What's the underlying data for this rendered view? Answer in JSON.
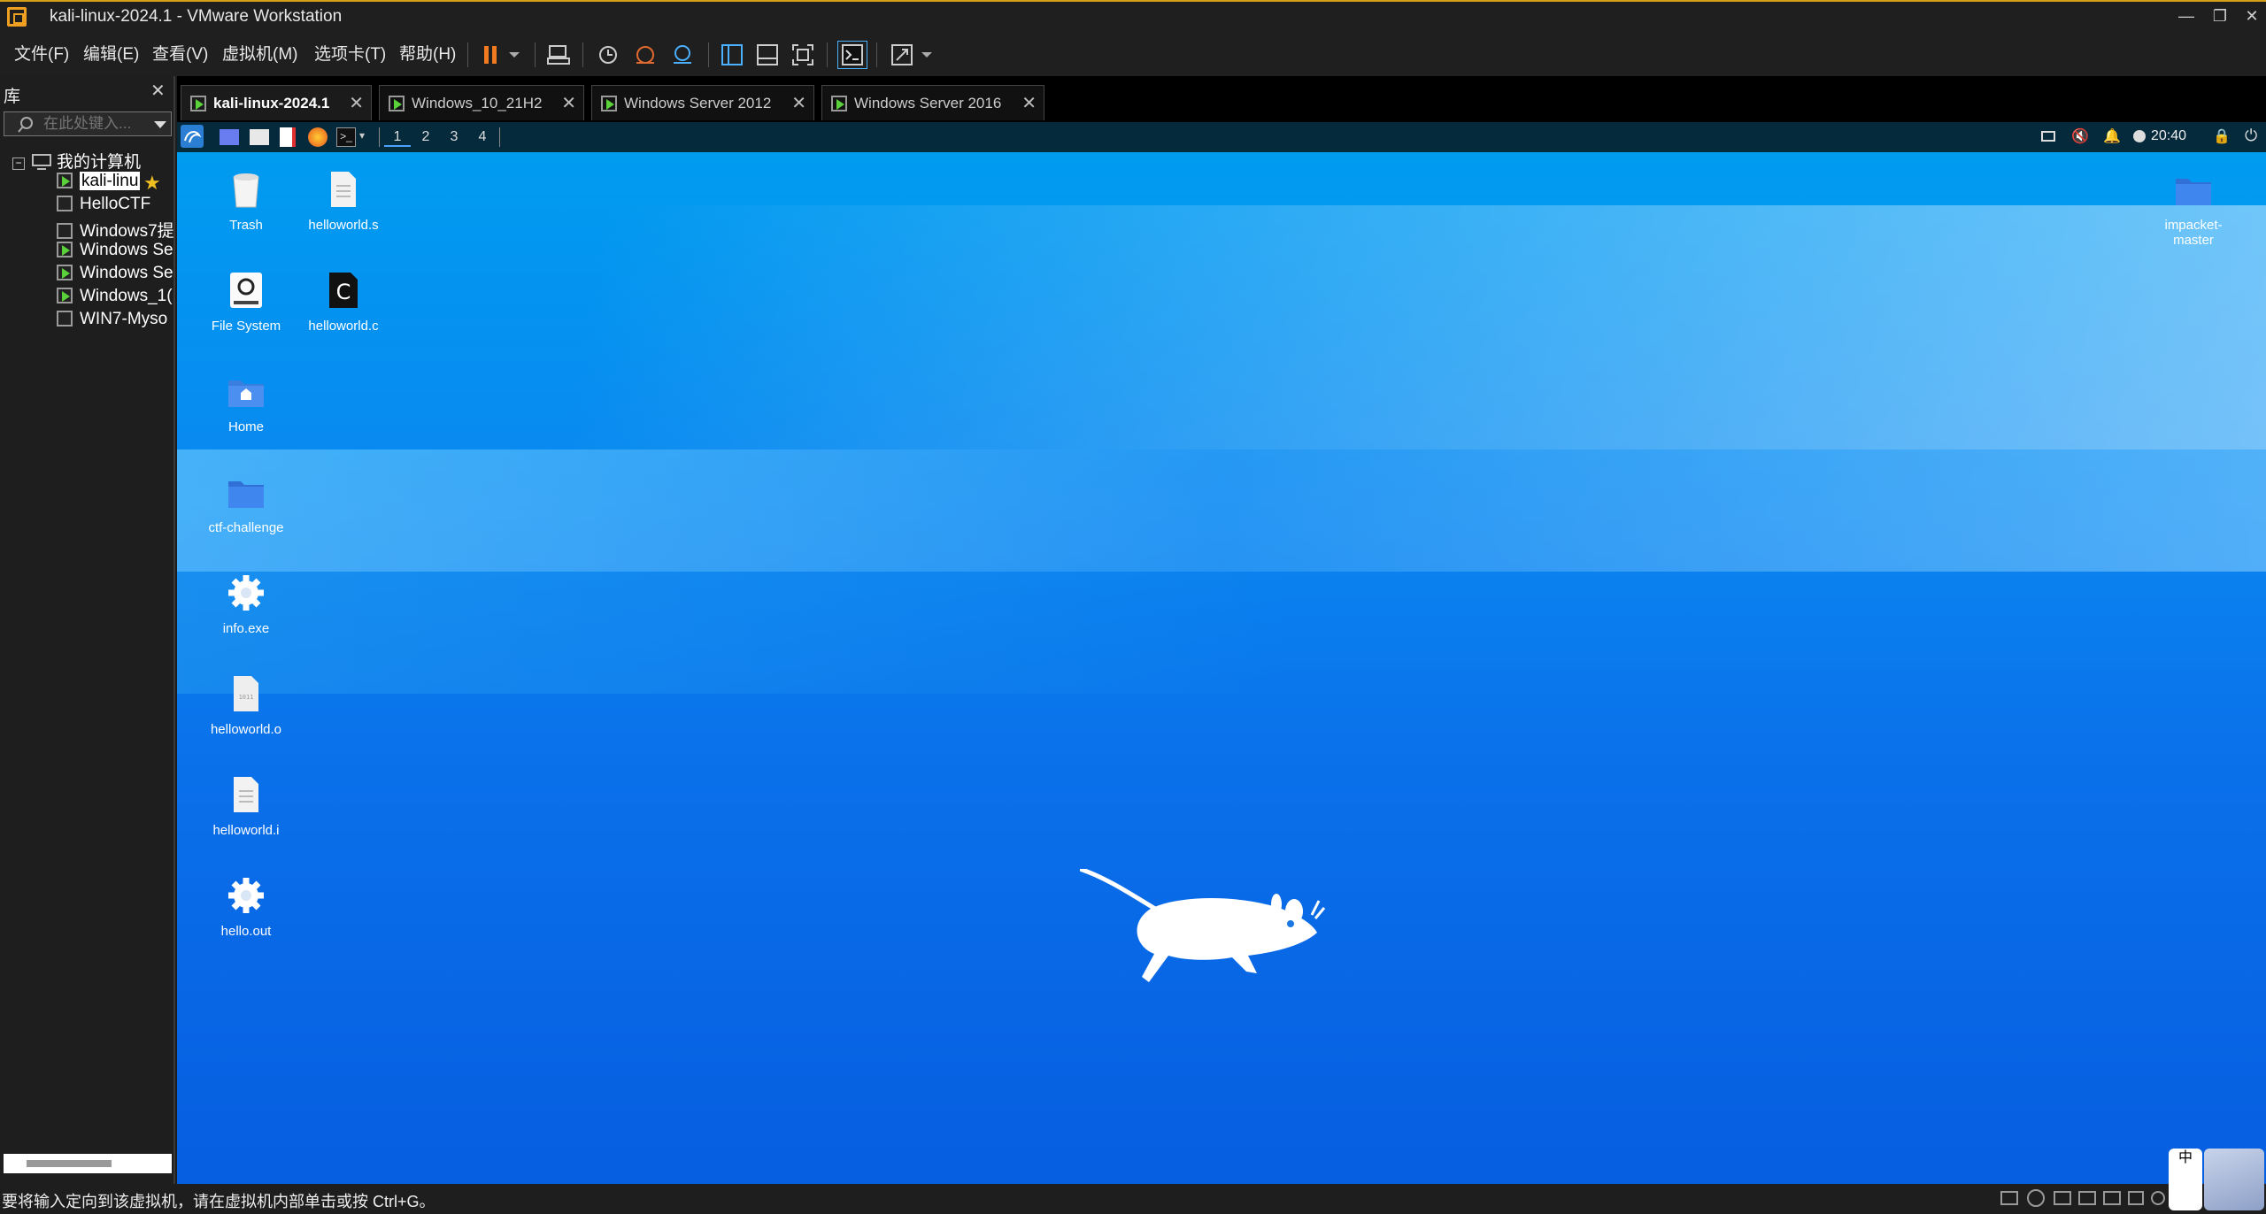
{
  "window": {
    "title": "kali-linux-2024.1 - VMware Workstation"
  },
  "menu": [
    "文件(F)",
    "编辑(E)",
    "查看(V)",
    "虚拟机(M)",
    "选项卡(T)",
    "帮助(H)"
  ],
  "library": {
    "title": "库",
    "search_placeholder": "在此处键入...",
    "root": "我的计算机",
    "vms": [
      {
        "name": "kali-linu",
        "running": true,
        "selected": true,
        "favorite": true
      },
      {
        "name": "HelloCTF",
        "running": false
      },
      {
        "name": "Windows7提",
        "running": false
      },
      {
        "name": "Windows Se",
        "running": true
      },
      {
        "name": "Windows Se",
        "running": true
      },
      {
        "name": "Windows_1(",
        "running": true
      },
      {
        "name": "WIN7-Myso",
        "running": false
      }
    ]
  },
  "tabs": [
    {
      "label": "kali-linux-2024.1",
      "active": true
    },
    {
      "label": "Windows_10_21H2",
      "active": false
    },
    {
      "label": "Windows Server 2012",
      "active": false
    },
    {
      "label": "Windows Server 2016",
      "active": false
    }
  ],
  "guest": {
    "workspaces": [
      "1",
      "2",
      "3",
      "4"
    ],
    "clock": "20:40",
    "desktop_icons": [
      {
        "label": "Trash",
        "icon": "trash-icon"
      },
      {
        "label": "helloworld.s",
        "icon": "text-file-icon"
      },
      {
        "label": "File System",
        "icon": "drive-icon"
      },
      {
        "label": "helloworld.c",
        "icon": "c-file-icon"
      },
      {
        "label": "Home",
        "icon": "home-folder-icon"
      },
      {
        "label": "ctf-challenge",
        "icon": "folder-icon"
      },
      {
        "label": "info.exe",
        "icon": "gear-icon"
      },
      {
        "label": "helloworld.o",
        "icon": "binary-file-icon"
      },
      {
        "label": "helloworld.i",
        "icon": "text-file-icon"
      },
      {
        "label": "hello.out",
        "icon": "gear-icon"
      },
      {
        "label": "impacket-master",
        "icon": "folder-icon"
      }
    ]
  },
  "status": {
    "message": "要将输入定向到该虚拟机，请在虚拟机内部单击或按 Ctrl+G。"
  },
  "colors": {
    "accent": "#f0a020",
    "run_green": "#5ad03a",
    "desktop_top": "#009cf0",
    "desktop_bottom": "#065ee0",
    "ime": "中"
  }
}
